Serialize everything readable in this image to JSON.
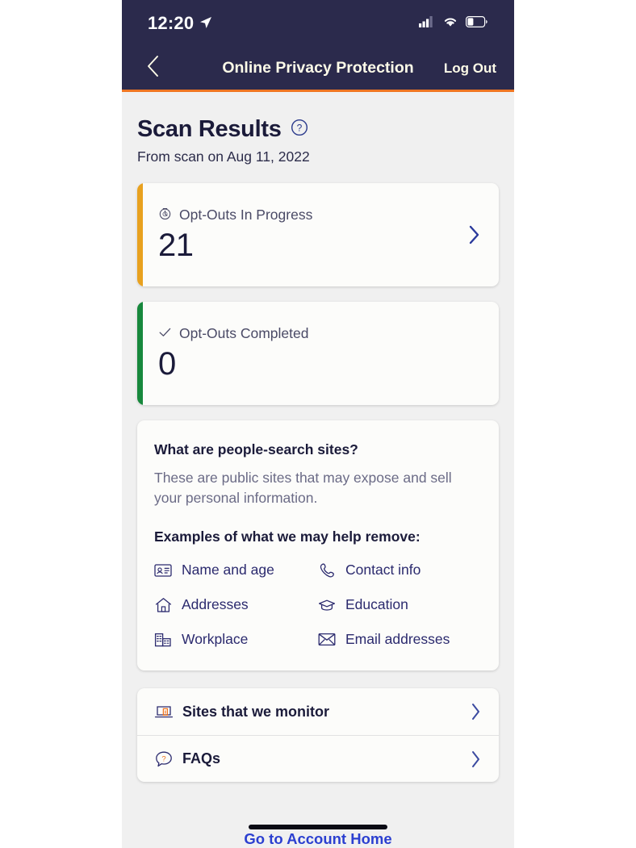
{
  "status_bar": {
    "time": "12:20",
    "location_icon": "location-arrow-icon",
    "signal_icon": "cellular-signal-icon",
    "wifi_icon": "wifi-icon",
    "battery_icon": "battery-icon",
    "battery_level_pct": 32
  },
  "nav": {
    "back_icon": "chevron-left-icon",
    "title": "Online Privacy Protection",
    "logout_label": "Log Out",
    "accent_color": "#ef7622",
    "bar_color": "#2b2a4c"
  },
  "header": {
    "title": "Scan Results",
    "help_icon": "question-circle-icon",
    "subtitle": "From scan on Aug 11, 2022"
  },
  "stat_cards": [
    {
      "icon": "clock-progress-icon",
      "label": "Opt-Outs In Progress",
      "value": "21",
      "accent_color": "#e8a11f",
      "has_chevron": true,
      "chevron_icon": "chevron-right-icon"
    },
    {
      "icon": "check-icon",
      "label": "Opt-Outs Completed",
      "value": "0",
      "accent_color": "#17883c",
      "has_chevron": false,
      "chevron_icon": ""
    }
  ],
  "info_card": {
    "heading": "What are people-search sites?",
    "body": "These are public sites that may expose and sell your personal information.",
    "examples_heading": "Examples of what we may help remove:",
    "examples": [
      {
        "icon": "id-card-icon",
        "label": "Name and age"
      },
      {
        "icon": "phone-icon",
        "label": "Contact info"
      },
      {
        "icon": "home-icon",
        "label": "Addresses"
      },
      {
        "icon": "graduation-cap-icon",
        "label": "Education"
      },
      {
        "icon": "office-building-icon",
        "label": "Workplace"
      },
      {
        "icon": "envelope-icon",
        "label": "Email addresses"
      }
    ]
  },
  "link_rows": [
    {
      "icon": "laptop-monitor-icon",
      "label": "Sites that we monitor",
      "chevron_icon": "chevron-right-icon"
    },
    {
      "icon": "question-bubble-icon",
      "label": "FAQs",
      "chevron_icon": "chevron-right-icon"
    }
  ],
  "footer": {
    "account_link_label": "Go to Account Home",
    "link_color": "#2b3fd0"
  }
}
